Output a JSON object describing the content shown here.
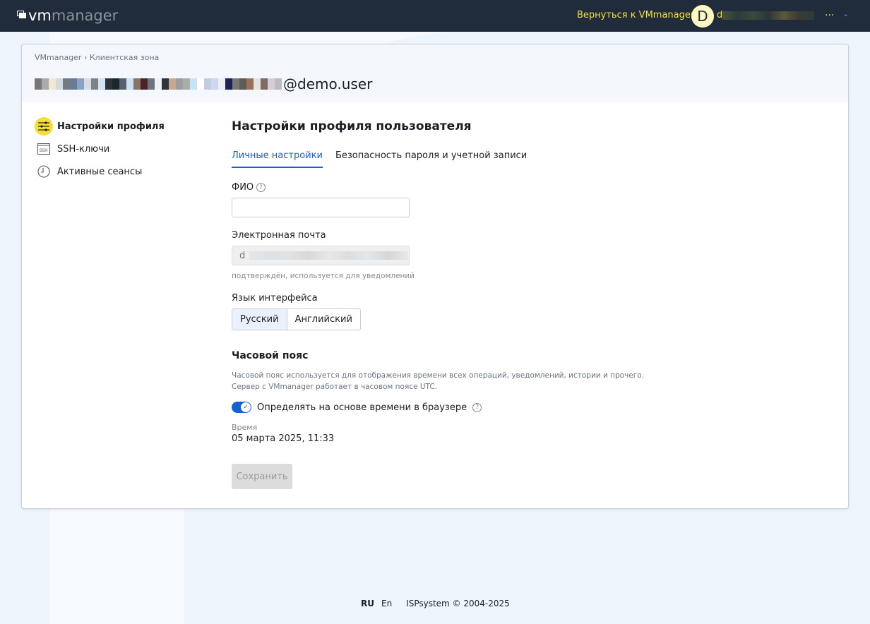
{
  "header": {
    "logo": "vmmanager",
    "logo_a": "vm",
    "logo_b": "manager",
    "back_link": "Вернуться к VMmanager",
    "avatar_letter": "D",
    "user_initial": "d",
    "more": "...",
    "accent": "#f5e33a"
  },
  "breadcrumb": {
    "items": [
      "VMmanager",
      "Клиентская зона"
    ],
    "separator": "›"
  },
  "page": {
    "user_suffix": "@demo.user"
  },
  "sidebar": {
    "items": [
      {
        "label": "Настройки профиля",
        "icon": "sliders-icon"
      },
      {
        "label": "SSH-ключи",
        "icon": "ssh-icon"
      },
      {
        "label": "Активные сеансы",
        "icon": "clock-icon"
      }
    ]
  },
  "main": {
    "title": "Настройки профиля пользователя",
    "tabs": [
      {
        "label": "Личные настройки"
      },
      {
        "label": "Безопасность пароля и учетной записи"
      }
    ],
    "fio_label": "ФИО",
    "fio_value": "",
    "email_label": "Электронная почта",
    "email_value_start": "d",
    "email_hint": "подтверждён, используется для уведомлений",
    "lang_label": "Язык интерфейса",
    "lang_options": [
      "Русский",
      "Английский"
    ],
    "tz_title": "Часовой пояс",
    "tz_desc1": "Часовой пояс используется для отображения времени всех операций, уведомлений, истории и прочего.",
    "tz_desc2": "Сервер с VMmanager работает в часовом поясе UTC.",
    "tz_toggle_label": "Определять на основе времени в браузере",
    "tz_toggle_on": true,
    "time_label": "Время",
    "time_value": "05 марта 2025, 11:33",
    "save": "Сохранить"
  },
  "footer": {
    "ru": "RU",
    "en": "En",
    "copyright": "ISPsystem © 2004-2025"
  }
}
